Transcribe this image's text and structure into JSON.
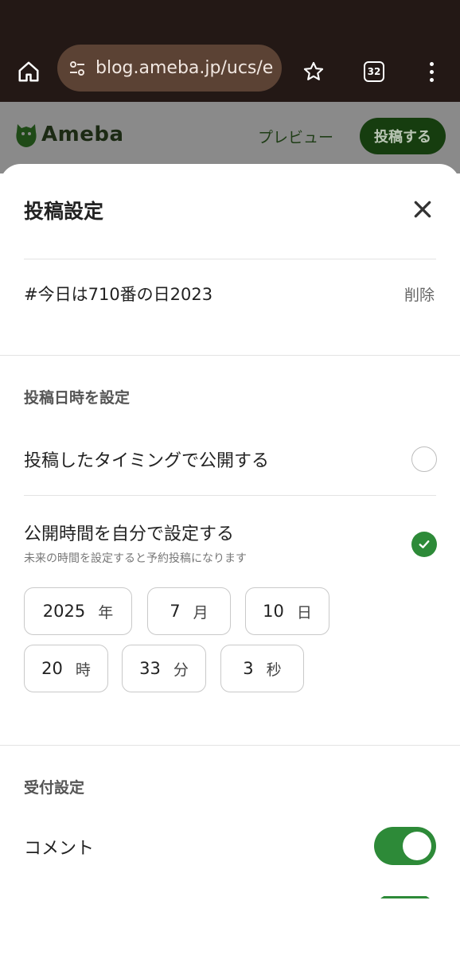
{
  "browser": {
    "url": "blog.ameba.jp/ucs/e",
    "tab_count": "32",
    "icons": {
      "home": "home-icon",
      "site_info": "tune-icon",
      "bookmark": "star-icon",
      "tabs": "tab-switcher-icon",
      "menu": "more-vert-icon"
    }
  },
  "header": {
    "logo_text": "Ameba",
    "preview_label": "プレビュー",
    "post_label": "投稿する"
  },
  "sheet": {
    "title": "投稿設定",
    "tag_text": "#今日は710番の日2023",
    "delete_label": "削除",
    "schedule_section": "投稿日時を設定",
    "option_immediate": "投稿したタイミングで公開する",
    "option_custom": "公開時間を自分で設定する",
    "option_custom_note": "未来の時間を設定すると予約投稿になります",
    "immediate_selected": false,
    "custom_selected": true,
    "date": {
      "year": "2025",
      "year_unit": "年",
      "month": "7",
      "month_unit": "月",
      "day": "10",
      "day_unit": "日",
      "hour": "20",
      "hour_unit": "時",
      "minute": "33",
      "minute_unit": "分",
      "second": "3",
      "second_unit": "秒"
    },
    "reception_section": "受付設定",
    "comment_label": "コメント",
    "comment_enabled": true
  },
  "colors": {
    "accent_green": "#2d8a38",
    "chrome_bg": "#231815",
    "urlbar_bg": "#5b4234"
  }
}
